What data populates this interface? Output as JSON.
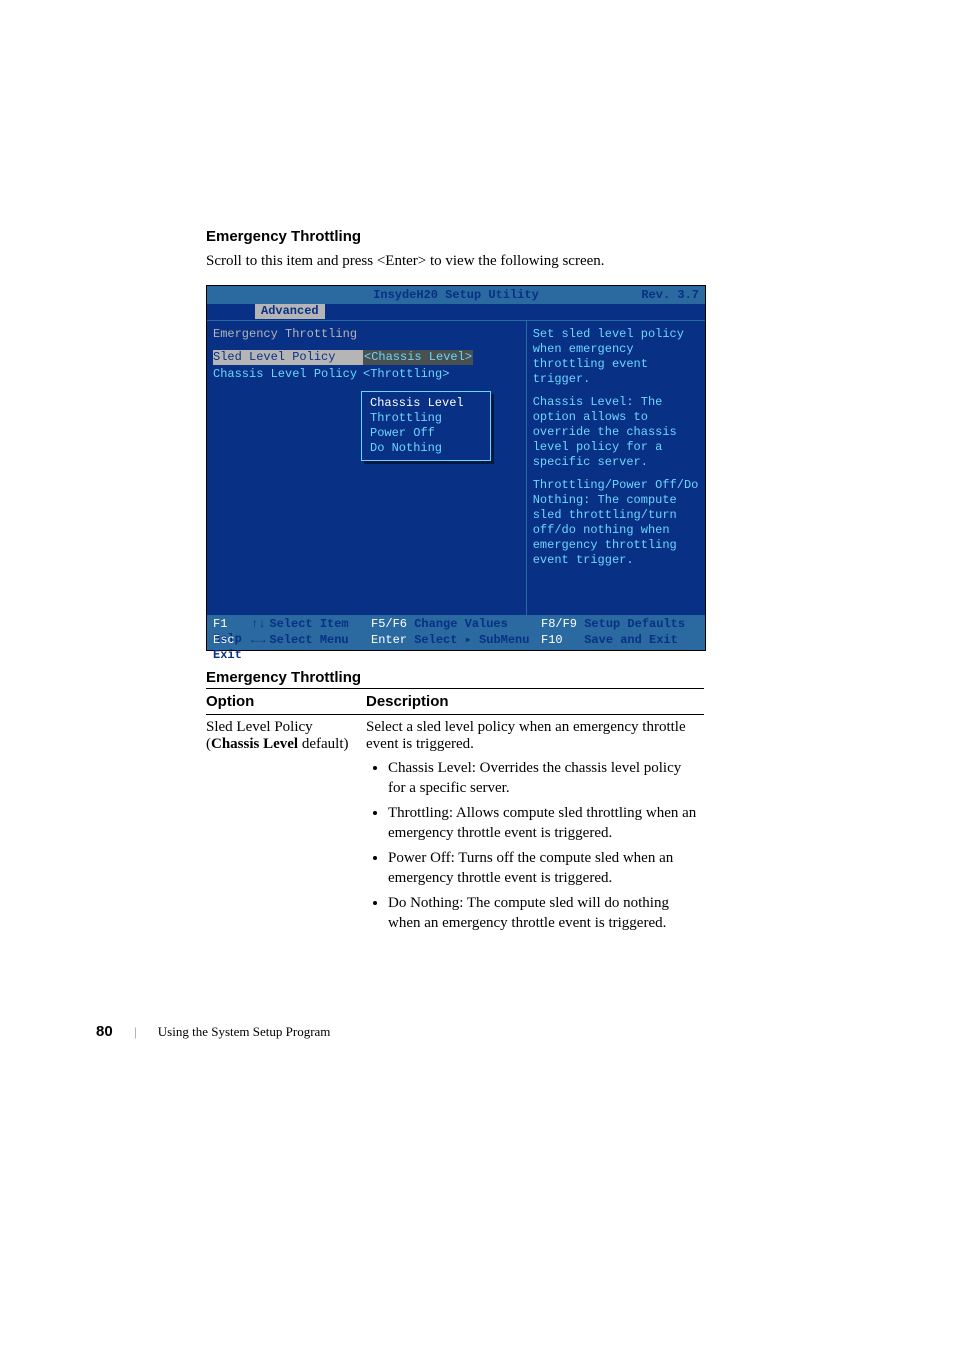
{
  "section": {
    "heading": "Emergency Throttling",
    "intro": "Scroll to this item and press <Enter> to view the following screen."
  },
  "bios": {
    "title": "InsydeH20 Setup Utility",
    "rev": "Rev. 3.7",
    "tab": "Advanced",
    "group_label": "Emergency Throttling",
    "rows": [
      {
        "label": "Sled Level Policy",
        "value": "<Chassis Level>",
        "selected": true
      },
      {
        "label": "Chassis Level Policy",
        "value": "<Throttling>",
        "selected": false
      }
    ],
    "dropdown": {
      "options": [
        "Chassis Level",
        "Throttling",
        "Power Off",
        "Do Nothing"
      ],
      "selected_index": 0
    },
    "help": [
      "Set sled level policy when emergency throttling event trigger.",
      "Chassis Level: The option allows to override the chassis level policy for a specific server.",
      "Throttling/Power Off/Do Nothing: The compute sled throttling/turn off/do nothing when emergency throttling event trigger."
    ],
    "footer": {
      "f1": "F1",
      "f1_label": "Help",
      "esc": "Esc",
      "esc_label": "Exit",
      "select_item": "Select Item",
      "select_menu": "Select Menu",
      "f5f6": "F5/F6",
      "f5f6_label": "Change Values",
      "enter": "Enter",
      "enter_label": "Select ▸ SubMenu",
      "f8f9": "F8/F9",
      "f8f9_label": "Setup Defaults",
      "f10": "F10",
      "f10_label": "Save and Exit"
    }
  },
  "table": {
    "title": "Emergency Throttling",
    "col_option": "Option",
    "col_desc": "Description",
    "option_name": "Sled Level Policy",
    "option_default": "(Chassis Level default)",
    "desc_header": "Select a sled level policy when an emergency throttle event is triggered.",
    "bullets": [
      "Chassis Level: Overrides the chassis level policy for a specific server.",
      "Throttling: Allows compute sled throttling when an emergency throttle event is triggered.",
      "Power Off: Turns off the compute sled when an emergency throttle event is triggered.",
      "Do Nothing: The compute sled will do nothing when an emergency throttle event is triggered."
    ]
  },
  "footer": {
    "page_number": "80",
    "separator": "|",
    "chapter": "Using the System Setup Program"
  }
}
